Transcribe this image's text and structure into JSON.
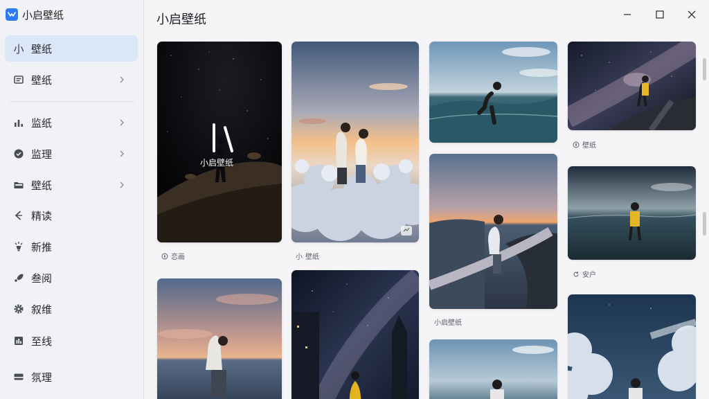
{
  "app": {
    "name": "小启壁纸",
    "brand_color": "#2f7bf5"
  },
  "sidebar": {
    "items": [
      {
        "label": "壁纸",
        "prefix": "小",
        "icon": "xiao-glyph-icon",
        "active": true,
        "chevron": false
      },
      {
        "label": "壁纸",
        "icon": "document-icon",
        "active": false,
        "chevron": true
      },
      {
        "label": "监纸",
        "icon": "bar-chart-icon",
        "active": false,
        "chevron": true
      },
      {
        "label": "监理",
        "icon": "check-circle-icon",
        "active": false,
        "chevron": true
      },
      {
        "label": "壁纸",
        "icon": "folder-icon",
        "active": false,
        "chevron": true
      },
      {
        "label": "精读",
        "icon": "back-arrow-icon",
        "active": false,
        "chevron": false
      },
      {
        "label": "新推",
        "icon": "lamp-icon",
        "active": false,
        "chevron": false
      },
      {
        "label": "叁阅",
        "icon": "rocket-icon",
        "active": false,
        "chevron": false
      },
      {
        "label": "叙维",
        "icon": "gear-icon",
        "active": false,
        "chevron": false
      },
      {
        "label": "至线",
        "icon": "stats-icon",
        "active": false,
        "chevron": false
      },
      {
        "label": "氛理",
        "icon": "card-icon",
        "active": false,
        "chevron": false
      }
    ]
  },
  "main": {
    "title": "小启壁纸",
    "cards": [
      {
        "overlay": "小启壁纸",
        "caption": "恋画",
        "caption_icon": "compass-icon"
      },
      {
        "caption": "壁纸",
        "caption_prefix": "小"
      },
      {
        "caption": "小启壁纸"
      },
      {
        "caption": "壁纸",
        "caption_icon": "compass-icon"
      },
      {
        "caption": "安户",
        "caption_icon": "refresh-icon"
      }
    ]
  }
}
